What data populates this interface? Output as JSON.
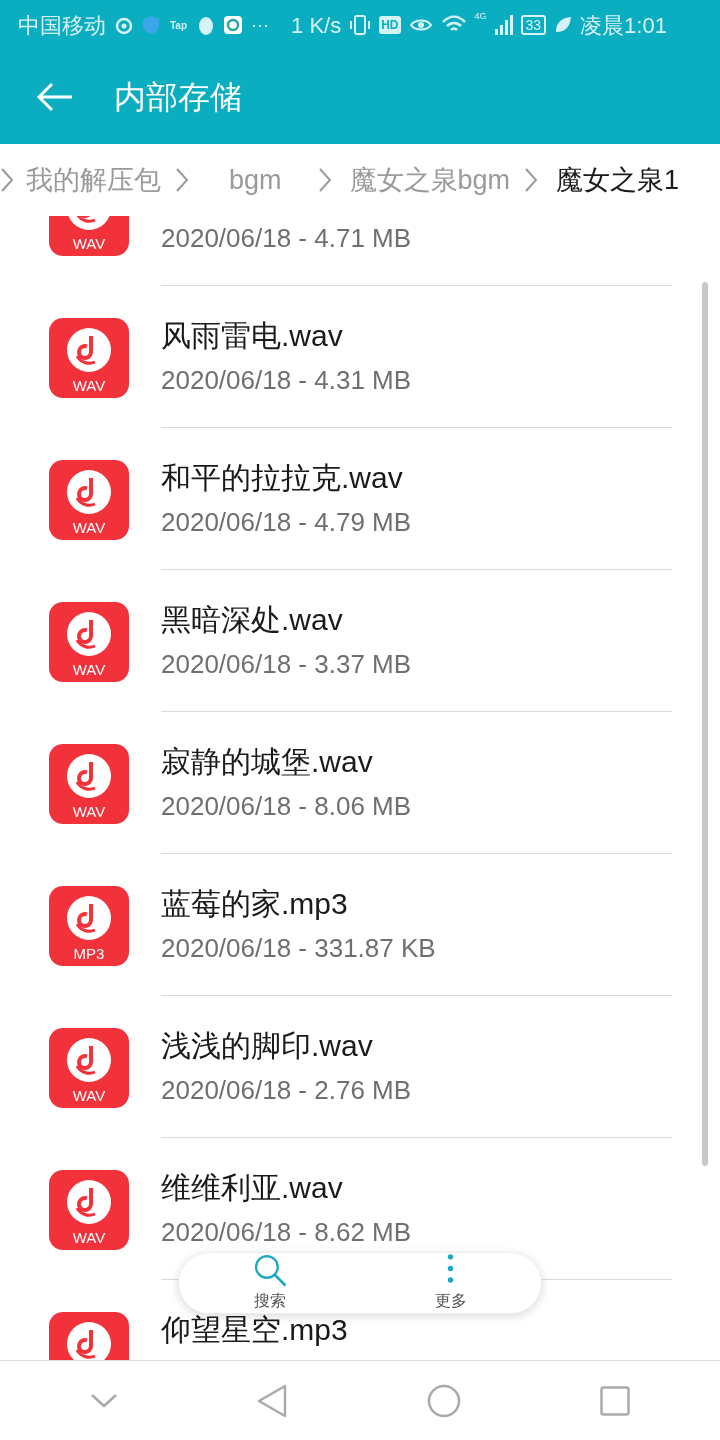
{
  "status_bar": {
    "carrier": "中国移动",
    "app_badge": "Tap",
    "more": "···",
    "speed": "1 K/s",
    "hd": "HD",
    "network": "4G",
    "battery": "33",
    "time": "凌晨1:01"
  },
  "header": {
    "title": "内部存储"
  },
  "breadcrumb": [
    {
      "label": "我的解压包",
      "selected": false
    },
    {
      "label": "bgm",
      "selected": false
    },
    {
      "label": "魔女之泉bgm",
      "selected": false
    },
    {
      "label": "魔女之泉1",
      "selected": true
    }
  ],
  "files": [
    {
      "type": "WAV",
      "meta": "2020/06/18 - 4.71 MB"
    },
    {
      "type": "WAV",
      "name": "风雨雷电.wav",
      "meta": "2020/06/18 - 4.31 MB"
    },
    {
      "type": "WAV",
      "name": "和平的拉拉克.wav",
      "meta": "2020/06/18 - 4.79 MB"
    },
    {
      "type": "WAV",
      "name": "黑暗深处.wav",
      "meta": "2020/06/18 - 3.37 MB"
    },
    {
      "type": "WAV",
      "name": "寂静的城堡.wav",
      "meta": "2020/06/18 - 8.06 MB"
    },
    {
      "type": "MP3",
      "name": "蓝莓的家.mp3",
      "meta": "2020/06/18 - 331.87 KB"
    },
    {
      "type": "WAV",
      "name": "浅浅的脚印.wav",
      "meta": "2020/06/18 - 2.76 MB"
    },
    {
      "type": "WAV",
      "name": "维维利亚.wav",
      "meta": "2020/06/18 - 8.62 MB"
    },
    {
      "name": "仰望星空.mp3"
    }
  ],
  "toolbar": [
    {
      "kind": "search",
      "label": "搜索"
    },
    {
      "kind": "more",
      "label": "更多"
    }
  ]
}
